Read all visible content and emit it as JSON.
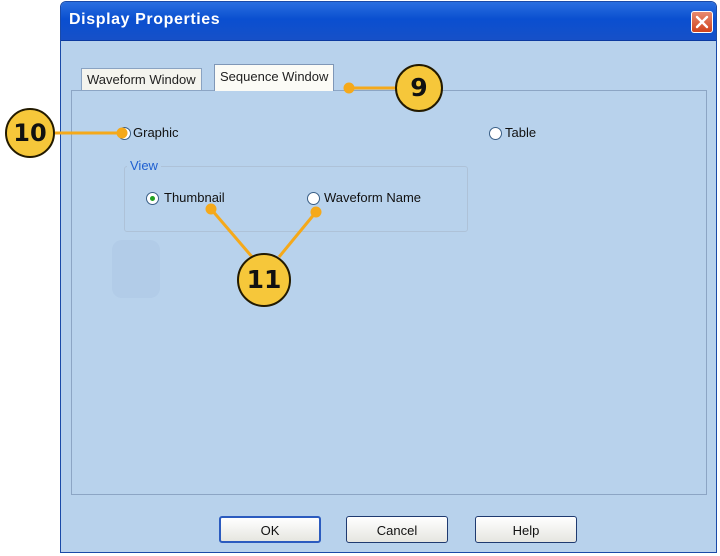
{
  "window": {
    "title": "Display Properties",
    "close_icon": "close-icon"
  },
  "tabs": [
    {
      "label": "Waveform Window",
      "selected": false
    },
    {
      "label": "Sequence Window",
      "selected": true
    }
  ],
  "display_mode": {
    "options": [
      {
        "label": "Graphic",
        "checked": false
      },
      {
        "label": "Table",
        "checked": false
      }
    ]
  },
  "view_group": {
    "legend": "View",
    "options": [
      {
        "label": "Thumbnail",
        "checked": true
      },
      {
        "label": "Waveform Name",
        "checked": false
      }
    ]
  },
  "buttons": {
    "ok": "OK",
    "cancel": "Cancel",
    "help": "Help"
  },
  "callouts": [
    "9",
    "10",
    "11"
  ],
  "colors": {
    "dialog_background": "#b8d2ec",
    "titlebar": "#0a4fd0",
    "callout_fill": "#f6c73a",
    "radio_selected_dot": "#21a121",
    "group_legend": "#1f5fd0"
  }
}
